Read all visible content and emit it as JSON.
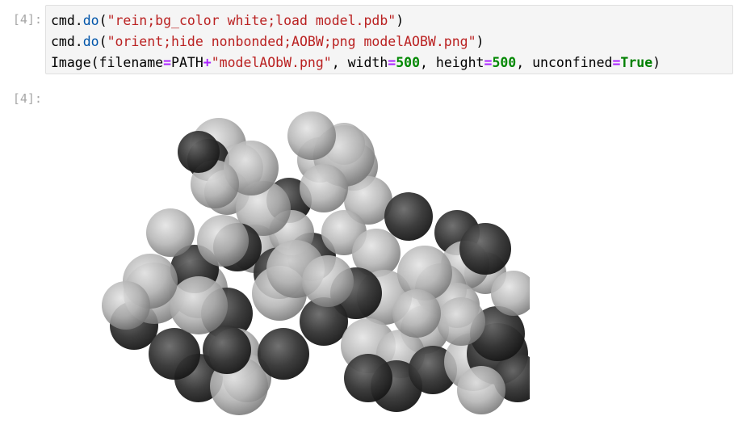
{
  "cells": [
    {
      "input_prompt": "[4]:",
      "output_prompt": "[4]:",
      "lines": [
        [
          {
            "t": "cmd.",
            "c": "plain"
          },
          {
            "t": "do",
            "c": "fn"
          },
          {
            "t": "(",
            "c": "plain"
          },
          {
            "t": "\"rein;bg_color white;load model.pdb\"",
            "c": "str"
          },
          {
            "t": ")",
            "c": "plain"
          }
        ],
        [
          {
            "t": "cmd.",
            "c": "plain"
          },
          {
            "t": "do",
            "c": "fn"
          },
          {
            "t": "(",
            "c": "plain"
          },
          {
            "t": "\"orient;hide nonbonded;AOBW;png modelAOBW.png\"",
            "c": "str"
          },
          {
            "t": ")",
            "c": "plain"
          }
        ],
        [
          {
            "t": "Image(filename",
            "c": "plain"
          },
          {
            "t": "=",
            "c": "op"
          },
          {
            "t": "PATH",
            "c": "plain"
          },
          {
            "t": "+",
            "c": "op"
          },
          {
            "t": "\"modelAObW.png\"",
            "c": "str"
          },
          {
            "t": ", width",
            "c": "plain"
          },
          {
            "t": "=",
            "c": "op"
          },
          {
            "t": "500",
            "c": "num"
          },
          {
            "t": ", height",
            "c": "plain"
          },
          {
            "t": "=",
            "c": "op"
          },
          {
            "t": "500",
            "c": "num"
          },
          {
            "t": ", unconfined",
            "c": "plain"
          },
          {
            "t": "=",
            "c": "op"
          },
          {
            "t": "True",
            "c": "kw"
          },
          {
            "t": ")",
            "c": "plain"
          }
        ]
      ]
    }
  ],
  "colors": {
    "function": "#0055aa",
    "string": "#ba2121",
    "operator": "#aa22ff",
    "number": "#008800",
    "keyword": "#008000",
    "prompt": "#a6a6a6",
    "cell_background": "#f5f5f5",
    "atom_light": "#c4c4c4",
    "atom_dark": "#3a3a3a"
  }
}
